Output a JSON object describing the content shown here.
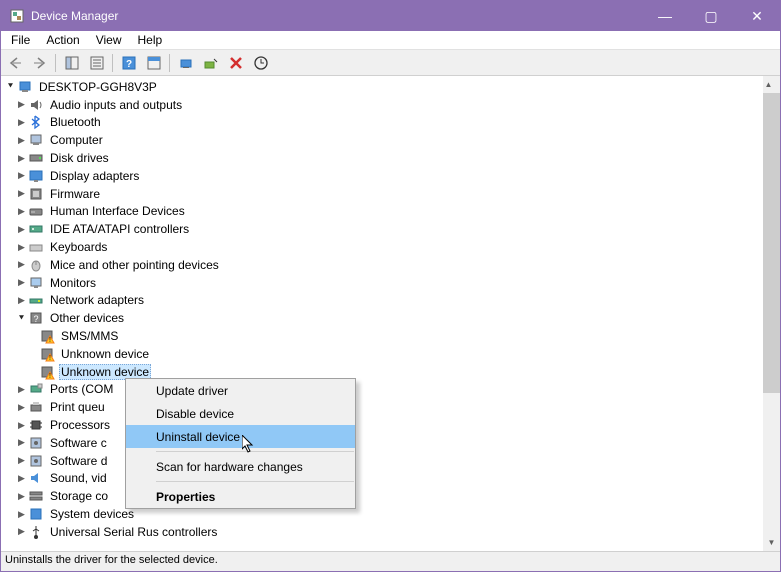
{
  "window": {
    "title": "Device Manager",
    "minimize": "—",
    "maximize": "▢",
    "close": "✕"
  },
  "menubar": [
    "File",
    "Action",
    "View",
    "Help"
  ],
  "tree": {
    "root": "DESKTOP-GGH8V3P",
    "nodes": [
      {
        "label": "Audio inputs and outputs",
        "icon": "audio"
      },
      {
        "label": "Bluetooth",
        "icon": "bluetooth"
      },
      {
        "label": "Computer",
        "icon": "computer"
      },
      {
        "label": "Disk drives",
        "icon": "disk"
      },
      {
        "label": "Display adapters",
        "icon": "display"
      },
      {
        "label": "Firmware",
        "icon": "firmware"
      },
      {
        "label": "Human Interface Devices",
        "icon": "hid"
      },
      {
        "label": "IDE ATA/ATAPI controllers",
        "icon": "ide"
      },
      {
        "label": "Keyboards",
        "icon": "keyboard"
      },
      {
        "label": "Mice and other pointing devices",
        "icon": "mouse"
      },
      {
        "label": "Monitors",
        "icon": "monitor"
      },
      {
        "label": "Network adapters",
        "icon": "network"
      },
      {
        "label": "Other devices",
        "icon": "other",
        "expanded": true,
        "children": [
          {
            "label": "SMS/MMS",
            "icon": "warn"
          },
          {
            "label": "Unknown device",
            "icon": "warn"
          },
          {
            "label": "Unknown device",
            "icon": "warn",
            "selected": true
          }
        ]
      },
      {
        "label": "Ports (COM",
        "icon": "ports"
      },
      {
        "label": "Print queu",
        "icon": "printer"
      },
      {
        "label": "Processors",
        "icon": "cpu"
      },
      {
        "label": "Software c",
        "icon": "software"
      },
      {
        "label": "Software d",
        "icon": "software"
      },
      {
        "label": "Sound, vid",
        "icon": "sound"
      },
      {
        "label": "Storage co",
        "icon": "storage"
      },
      {
        "label": "System devices",
        "icon": "system"
      },
      {
        "label": "Universal Serial Rus controllers",
        "icon": "usb"
      }
    ]
  },
  "context_menu": [
    {
      "label": "Update driver"
    },
    {
      "label": "Disable device"
    },
    {
      "label": "Uninstall device",
      "hover": true
    },
    {
      "sep": true
    },
    {
      "label": "Scan for hardware changes"
    },
    {
      "sep": true
    },
    {
      "label": "Properties",
      "bold": true
    }
  ],
  "statusbar": "Uninstalls the driver for the selected device."
}
